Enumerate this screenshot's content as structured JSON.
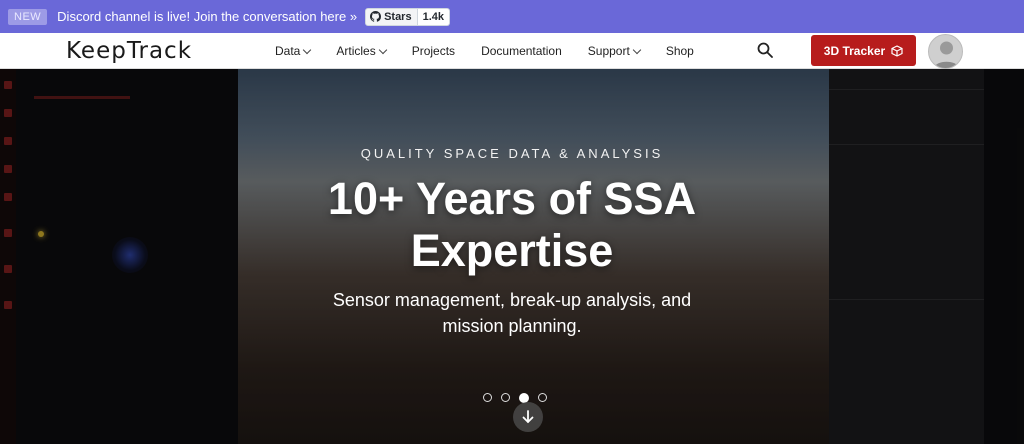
{
  "announcement": {
    "badge": "NEW",
    "message": "Discord channel is live! Join the conversation here »",
    "github_stars_label": "Stars",
    "github_star_count": "1.4k"
  },
  "nav": {
    "logo": "KeepTrack",
    "items": [
      {
        "label": "Data",
        "dropdown": true
      },
      {
        "label": "Articles",
        "dropdown": true
      },
      {
        "label": "Projects",
        "dropdown": false
      },
      {
        "label": "Documentation",
        "dropdown": false
      },
      {
        "label": "Support",
        "dropdown": true
      },
      {
        "label": "Shop",
        "dropdown": false
      }
    ],
    "search_icon": "search-icon",
    "cta_label": "3D Tracker",
    "cta_icon": "cube-icon",
    "avatar_icon": "user-avatar"
  },
  "hero": {
    "eyebrow": "QUALITY SPACE DATA & ANALYSIS",
    "headline_line1": "10+ Years of SSA",
    "headline_line2": "Expertise",
    "subtitle": "Sensor management, break-up analysis, and mission planning.",
    "slides_total": 4,
    "active_slide": 3,
    "scroll_icon": "arrow-down-icon"
  },
  "colors": {
    "announcement_bg": "#6a68d8",
    "cta_bg": "#b71c1c",
    "nav_bg": "#ffffff"
  }
}
